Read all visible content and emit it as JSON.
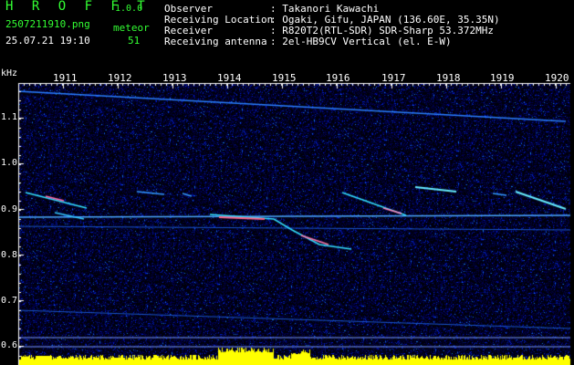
{
  "app": {
    "name": "H R O F F T",
    "version": "1.0.0"
  },
  "image": {
    "filename": "2507211910.png",
    "datetime": "25.07.21 19:10"
  },
  "meteor": {
    "label": "meteor",
    "count": "51"
  },
  "station": {
    "rows": [
      {
        "label": "Observer",
        "value": ": Takanori Kawachi"
      },
      {
        "label": "Receiving Location",
        "value": ": Ogaki, Gifu, JAPAN (136.60E, 35.35N)"
      },
      {
        "label": "Receiver",
        "value": ": R820T2(RTL-SDR) SDR-Sharp 53.372MHz"
      },
      {
        "label": "Receiving antenna",
        "value": ": 2el-HB9CV Vertical (el. E-W)"
      }
    ]
  },
  "axis": {
    "y_unit": "kHz",
    "y_ticks": [
      "1.1",
      "1.0",
      "0.9",
      "0.8",
      "0.7",
      "0.6"
    ],
    "x_ticks": [
      "1911",
      "1912",
      "1913",
      "1914",
      "1915",
      "1916",
      "1917",
      "1918",
      "1919",
      "1920"
    ]
  },
  "colors": {
    "header_green": "#33ff33",
    "trail_cyan": "#33e0ff",
    "background": "#000000",
    "level_bar": "#ffff00",
    "level_line": "#7799ff"
  }
}
